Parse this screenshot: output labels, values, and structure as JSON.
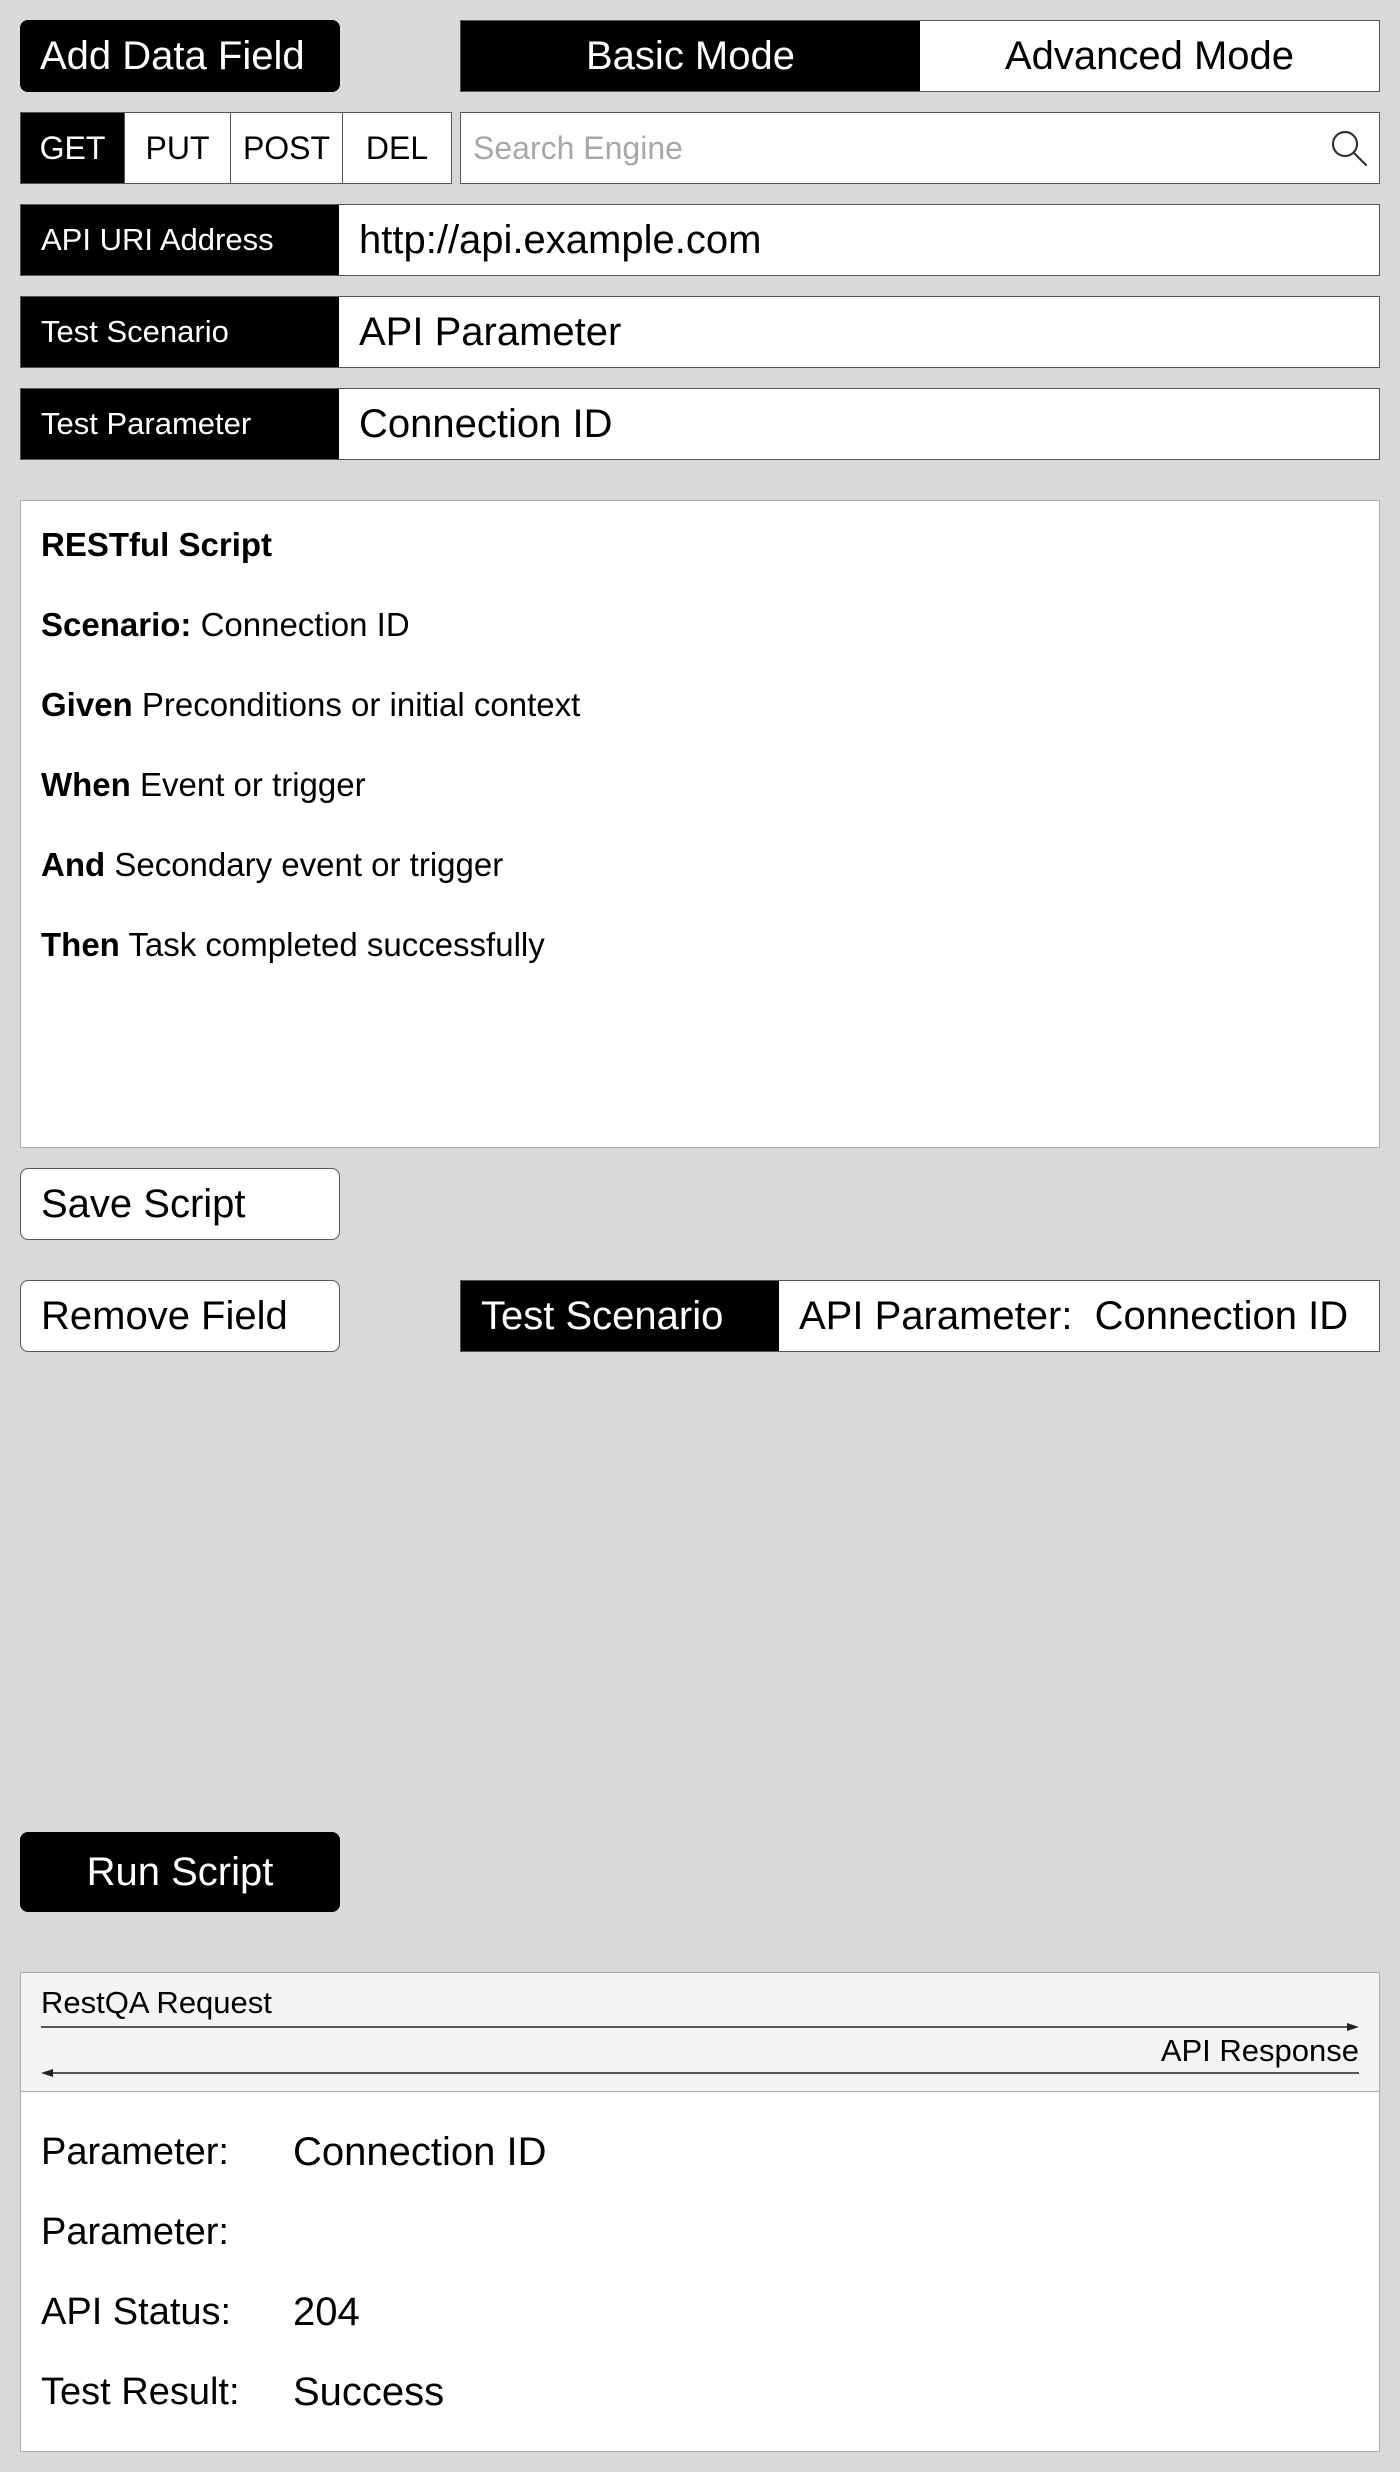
{
  "toolbar": {
    "add_field_label": "Add Data Field",
    "modes": [
      {
        "label": "Basic Mode",
        "active": true
      },
      {
        "label": "Advanced Mode",
        "active": false
      }
    ]
  },
  "methods": [
    {
      "label": "GET",
      "active": true
    },
    {
      "label": "PUT",
      "active": false
    },
    {
      "label": "POST",
      "active": false
    },
    {
      "label": "DEL",
      "active": false
    }
  ],
  "search": {
    "placeholder": "Search Engine",
    "value": "",
    "icon": "search-icon"
  },
  "fields": {
    "uri": {
      "label": "API URI Address",
      "value": "http://api.example.com"
    },
    "scenario": {
      "label": "Test Scenario",
      "value": "API Parameter"
    },
    "parameter": {
      "label": "Test Parameter",
      "value": "Connection ID"
    }
  },
  "script": {
    "title": "RESTful Script",
    "lines": [
      {
        "keyword": "Scenario:",
        "text": "Connection ID"
      },
      {
        "keyword": "Given",
        "text": "Preconditions or initial context"
      },
      {
        "keyword": "When",
        "text": "Event or trigger"
      },
      {
        "keyword": "And",
        "text": "Secondary event or trigger"
      },
      {
        "keyword": "Then",
        "text": "Task completed successfully"
      }
    ]
  },
  "actions": {
    "save_label": "Save Script",
    "remove_label": "Remove Field",
    "run_label": "Run Script"
  },
  "scenario_tag": {
    "key": "Test Scenario",
    "value": "API Parameter:  Connection ID"
  },
  "result": {
    "request_label": "RestQA Request",
    "response_label": "API Response",
    "rows": [
      {
        "key": "Parameter:",
        "value": "Connection ID"
      },
      {
        "key": "Parameter:",
        "value": ""
      },
      {
        "key": "API Status:",
        "value": "204"
      },
      {
        "key": "Test Result:",
        "value": "Success"
      }
    ]
  }
}
